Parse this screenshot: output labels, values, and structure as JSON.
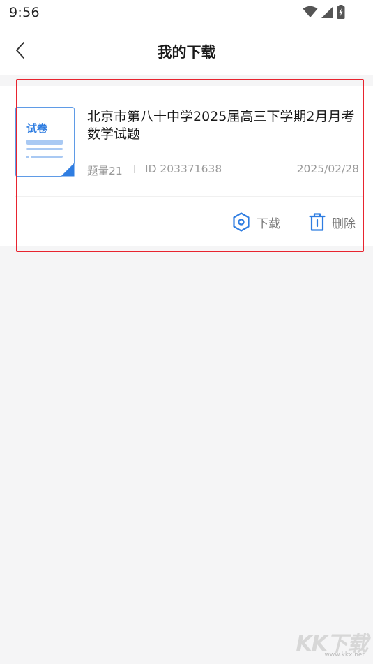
{
  "status_bar": {
    "time": "9:56",
    "icons": [
      "wifi-icon",
      "signal-icon",
      "battery-charging-icon"
    ]
  },
  "header": {
    "title": "我的下载",
    "back_icon": "chevron-left-icon"
  },
  "download_item": {
    "thumbnail_label": "试卷",
    "title": "北京市第八十中学2025届高三下学期2月月考数学试题",
    "question_count": "题量21",
    "id_text": "ID 203371638",
    "date": "2025/02/28",
    "download_label": "下载",
    "delete_label": "删除"
  },
  "watermark": {
    "brand": "KK下载",
    "url": "www.kkx.net"
  },
  "colors": {
    "accent": "#2f7de1",
    "highlight": "#e8242f",
    "background": "#f5f5f6"
  }
}
